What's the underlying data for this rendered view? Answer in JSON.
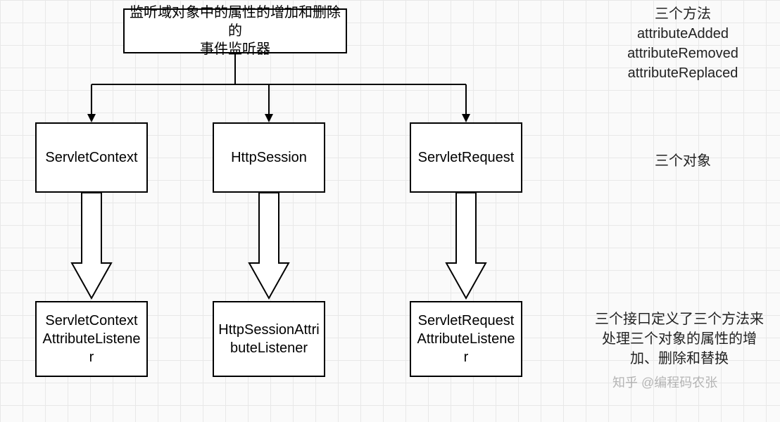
{
  "diagram": {
    "root": {
      "line1": "监听域对象中的属性的增加和删除的",
      "line2": "事件监听器"
    },
    "row2": {
      "a": "ServletContext",
      "b": "HttpSession",
      "c": "ServletRequest"
    },
    "row3": {
      "a": "ServletContextAttributeListener",
      "b": "HttpSessionAttributeListener",
      "c": "ServletRequestAttributeListener"
    }
  },
  "notes": {
    "methods": {
      "line1": "三个方法",
      "line2": "attributeAdded",
      "line3": "attributeRemoved",
      "line4": "attributeReplaced"
    },
    "objects": "三个对象",
    "interfaces": {
      "line1": "三个接口定义了三个方法来",
      "line2": "处理三个对象的属性的增",
      "line3": "加、删除和替换"
    }
  },
  "watermark": "知乎 @编程码农张"
}
